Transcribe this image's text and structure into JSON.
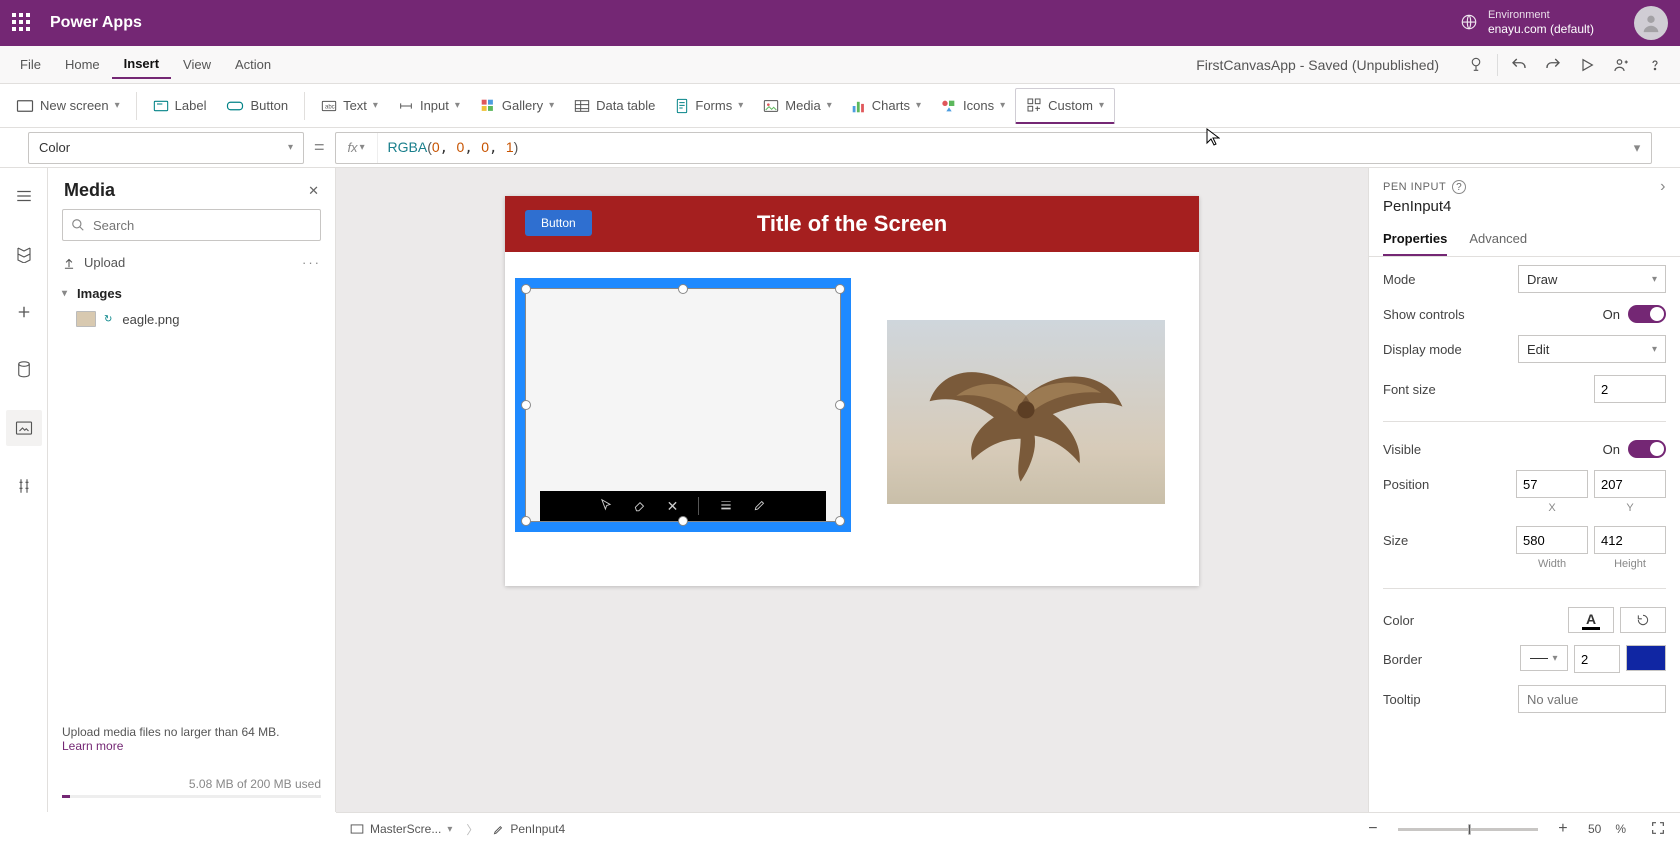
{
  "header": {
    "app": "Power Apps",
    "env_label": "Environment",
    "env_value": "enayu.com (default)"
  },
  "menu": {
    "items": [
      "File",
      "Home",
      "Insert",
      "View",
      "Action"
    ],
    "active": "Insert",
    "doc_title": "FirstCanvasApp - Saved (Unpublished)"
  },
  "ribbon": {
    "new_screen": "New screen",
    "label": "Label",
    "button": "Button",
    "text": "Text",
    "input": "Input",
    "gallery": "Gallery",
    "datatable": "Data table",
    "forms": "Forms",
    "media": "Media",
    "charts": "Charts",
    "icons": "Icons",
    "custom": "Custom"
  },
  "formula": {
    "property": "Color",
    "fn": "RGBA",
    "args": [
      "0",
      "0",
      "0",
      "1"
    ]
  },
  "media_panel": {
    "title": "Media",
    "search_placeholder": "Search",
    "upload": "Upload",
    "section": "Images",
    "items": [
      "eagle.png"
    ],
    "footer_line": "Upload media files no larger than 64 MB.",
    "learn_more": "Learn more",
    "usage": "5.08 MB of 200 MB used"
  },
  "canvas": {
    "screen_title": "Title of the Screen",
    "button_label": "Button"
  },
  "breadcrumb": {
    "screen": "MasterScre...",
    "control": "PenInput4"
  },
  "zoom": {
    "value": "50",
    "unit": "%"
  },
  "properties": {
    "type": "PEN INPUT",
    "name": "PenInput4",
    "tabs": [
      "Properties",
      "Advanced"
    ],
    "mode_label": "Mode",
    "mode_value": "Draw",
    "showctrls_label": "Show controls",
    "showctrls_value": "On",
    "display_label": "Display mode",
    "display_value": "Edit",
    "fontsize_label": "Font size",
    "fontsize_value": "2",
    "visible_label": "Visible",
    "visible_value": "On",
    "position_label": "Position",
    "pos_x": "57",
    "pos_y": "207",
    "pos_xl": "X",
    "pos_yl": "Y",
    "size_label": "Size",
    "size_w": "580",
    "size_h": "412",
    "size_wl": "Width",
    "size_hl": "Height",
    "color_label": "Color",
    "border_label": "Border",
    "border_val": "2",
    "tooltip_label": "Tooltip",
    "tooltip_ph": "No value"
  }
}
